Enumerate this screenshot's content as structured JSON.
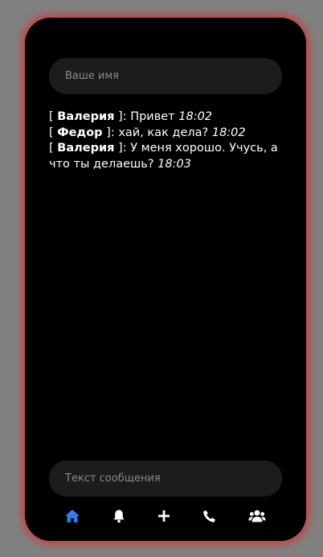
{
  "form": {
    "name_placeholder": "Ваше имя",
    "message_placeholder": "Текст сообщения"
  },
  "messages": [
    {
      "author": "Валерия",
      "text": "Привет",
      "time": "18:02"
    },
    {
      "author": "Федор",
      "text": "хай, как дела?",
      "time": "18:02"
    },
    {
      "author": "Валерия",
      "text": "У меня хорошо. Учусь, а что ты делаешь?",
      "time": "18:03"
    }
  ],
  "nav": {
    "items": [
      {
        "icon": "home-icon",
        "active": true
      },
      {
        "icon": "bell-icon",
        "active": false
      },
      {
        "icon": "plus-icon",
        "active": false
      },
      {
        "icon": "phone-icon",
        "active": false
      },
      {
        "icon": "users-icon",
        "active": false
      }
    ]
  },
  "colors": {
    "background": "#808080",
    "screen": "#000000",
    "input": "#1c1c1c",
    "accent": "#2f7bf0",
    "glow": "#e62828",
    "text": "#ffffff"
  }
}
